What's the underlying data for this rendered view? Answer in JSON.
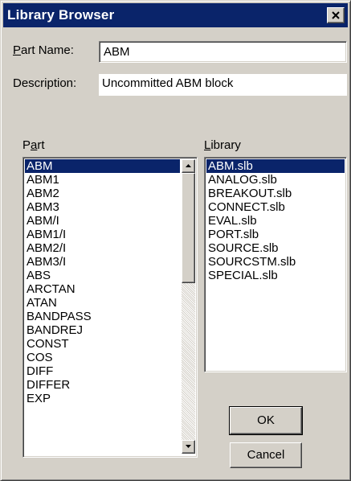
{
  "window": {
    "title": "Library Browser"
  },
  "form": {
    "part_name_label": "Part Name:",
    "part_name_value": "ABM",
    "description_label": "Description:",
    "description_value": "Uncommitted ABM block"
  },
  "part_list": {
    "label": "Part",
    "selected": "ABM",
    "items": [
      "ABM",
      "ABM1",
      "ABM2",
      "ABM3",
      "ABM/I",
      "ABM1/I",
      "ABM2/I",
      "ABM3/I",
      "ABS",
      "ARCTAN",
      "ATAN",
      "BANDPASS",
      "BANDREJ",
      "CONST",
      "COS",
      "DIFF",
      "DIFFER",
      "EXP"
    ]
  },
  "library_list": {
    "label": "Library",
    "selected": "ABM.slb",
    "items": [
      "ABM.slb",
      "ANALOG.slb",
      "BREAKOUT.slb",
      "CONNECT.slb",
      "EVAL.slb",
      "PORT.slb",
      "SOURCE.slb",
      "SOURCSTM.slb",
      "SPECIAL.slb"
    ]
  },
  "buttons": {
    "ok": "OK",
    "cancel": "Cancel"
  },
  "colors": {
    "title_bar": "#0a246a",
    "selection": "#0a246a",
    "face": "#d4d0c8"
  },
  "icons": {
    "close": "close-icon",
    "scroll_up": "arrow-up-icon",
    "scroll_down": "arrow-down-icon"
  }
}
